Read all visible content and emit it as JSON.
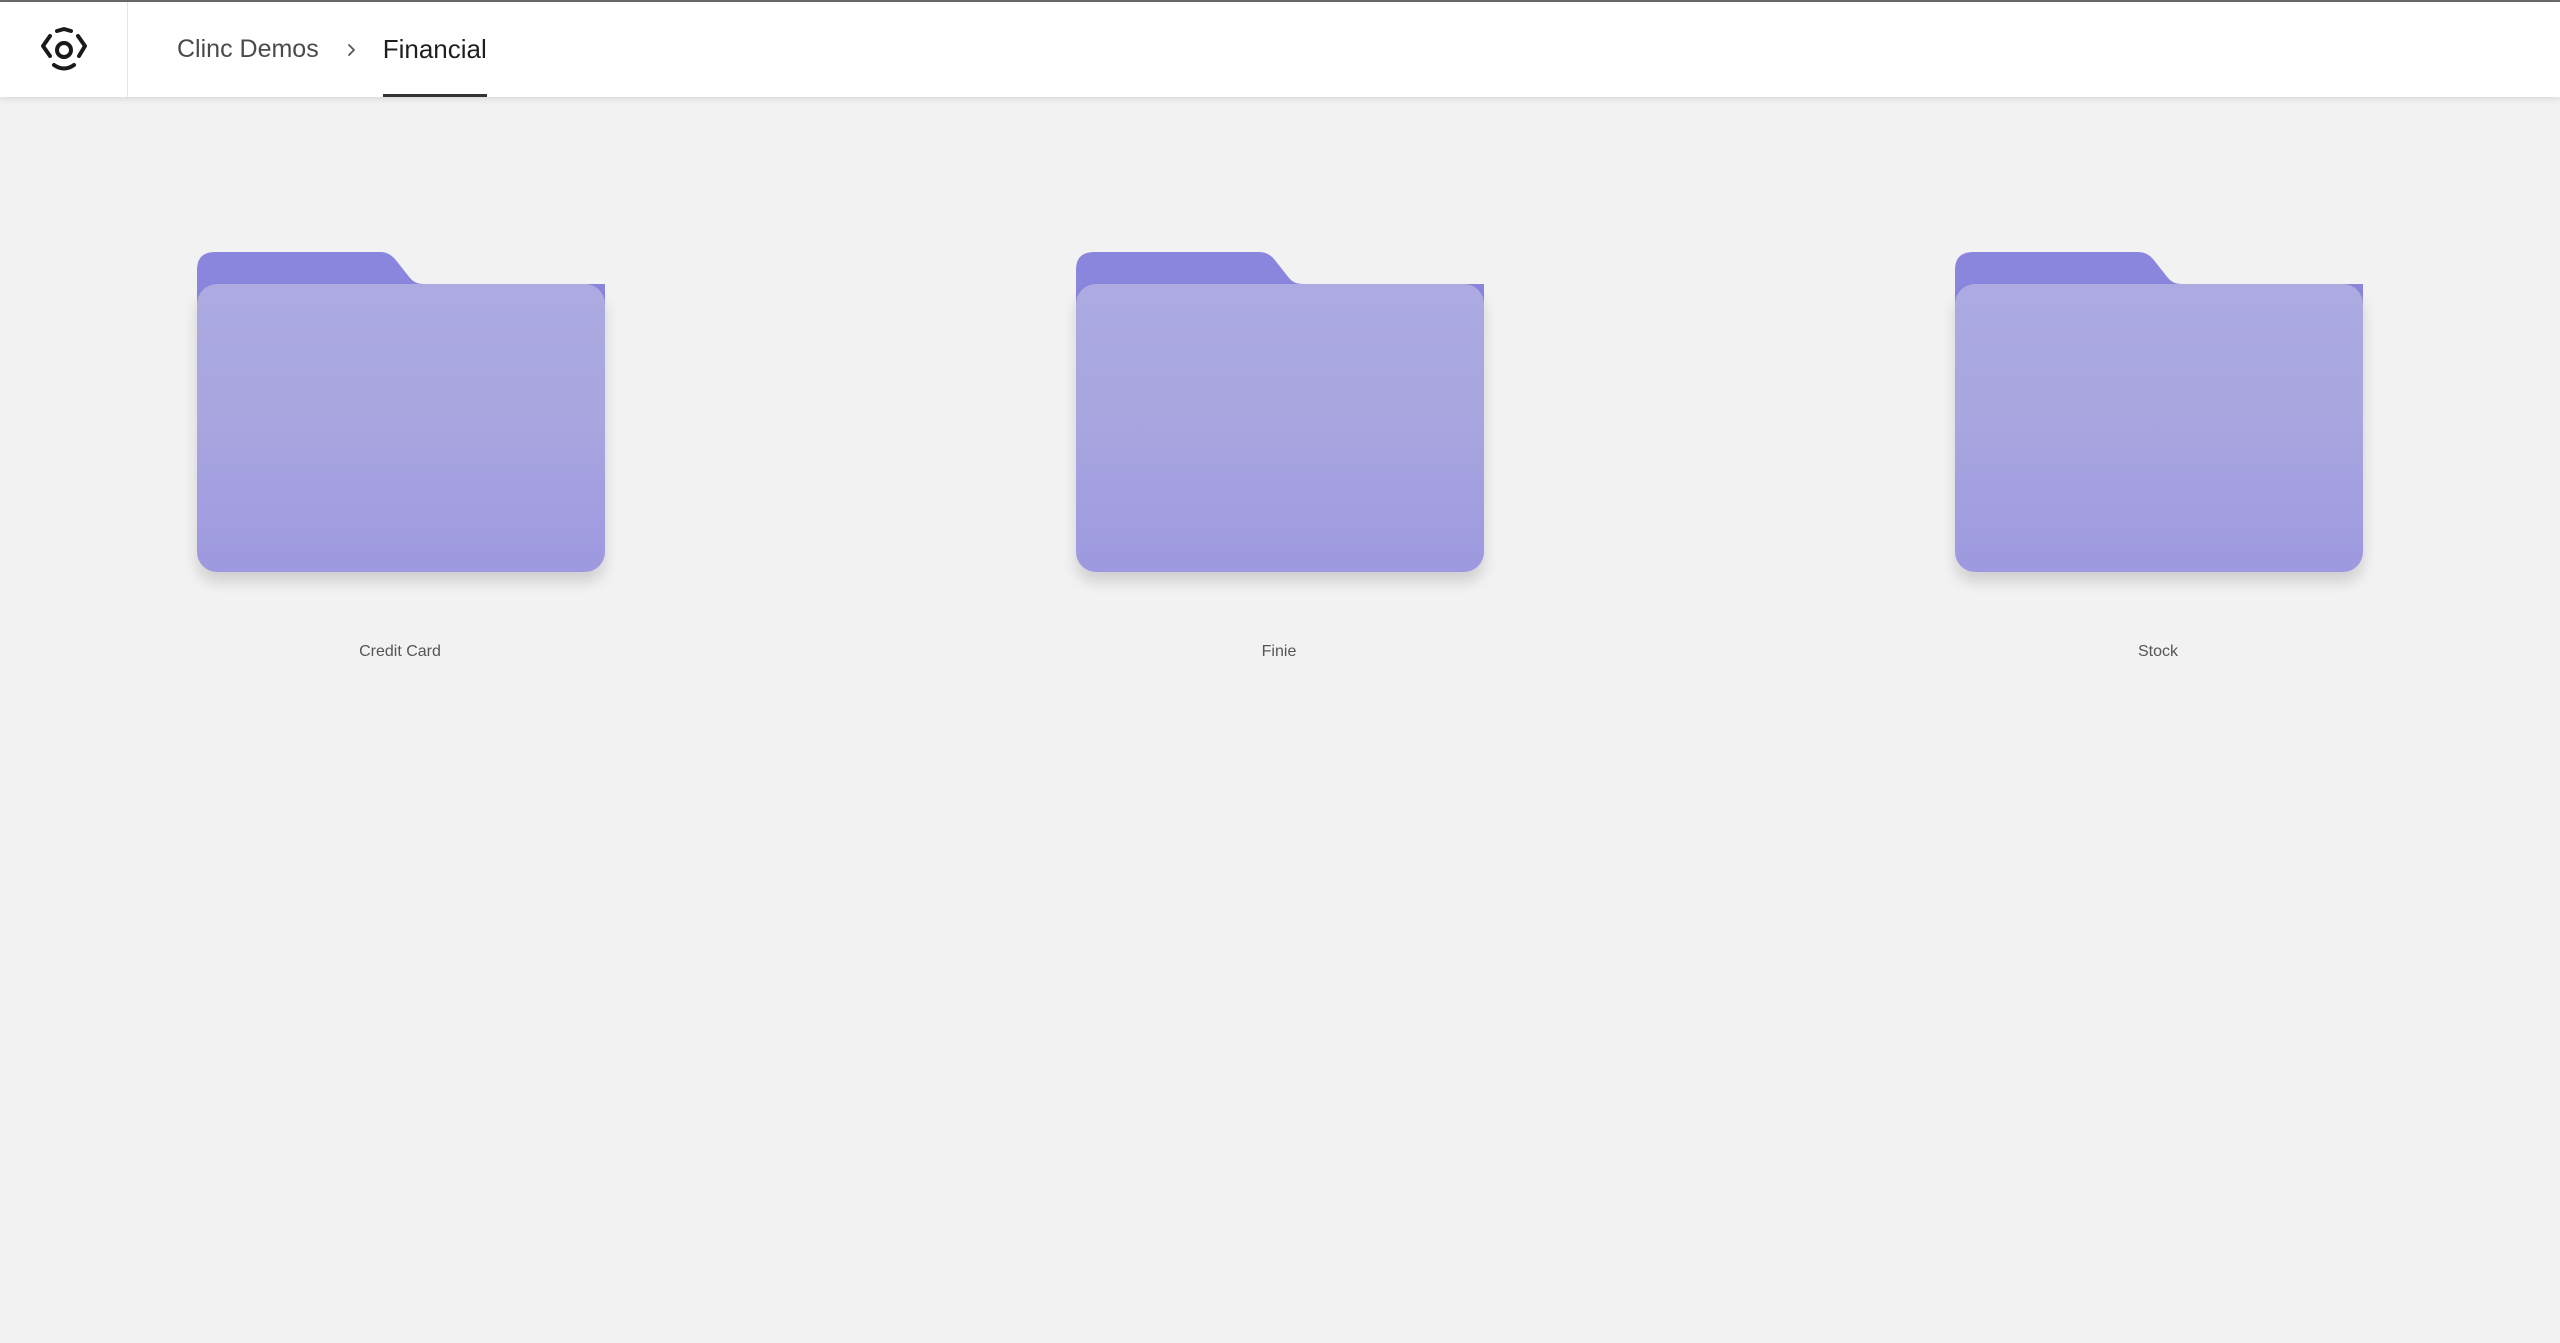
{
  "header": {
    "logo_icon": "clinc-logo-icon",
    "breadcrumb": {
      "root": "Clinc Demos",
      "separator_icon": "chevron-right-icon",
      "current": "Financial"
    }
  },
  "folders": [
    {
      "label": "Credit Card",
      "icon": "folder-icon"
    },
    {
      "label": "Finie",
      "icon": "folder-icon"
    },
    {
      "label": "Stock",
      "icon": "folder-icon"
    }
  ],
  "colors": {
    "background": "#f2f2f2",
    "header": "#ffffff",
    "folder_back": "#8a86de",
    "folder_front": "#a9a6e0"
  }
}
